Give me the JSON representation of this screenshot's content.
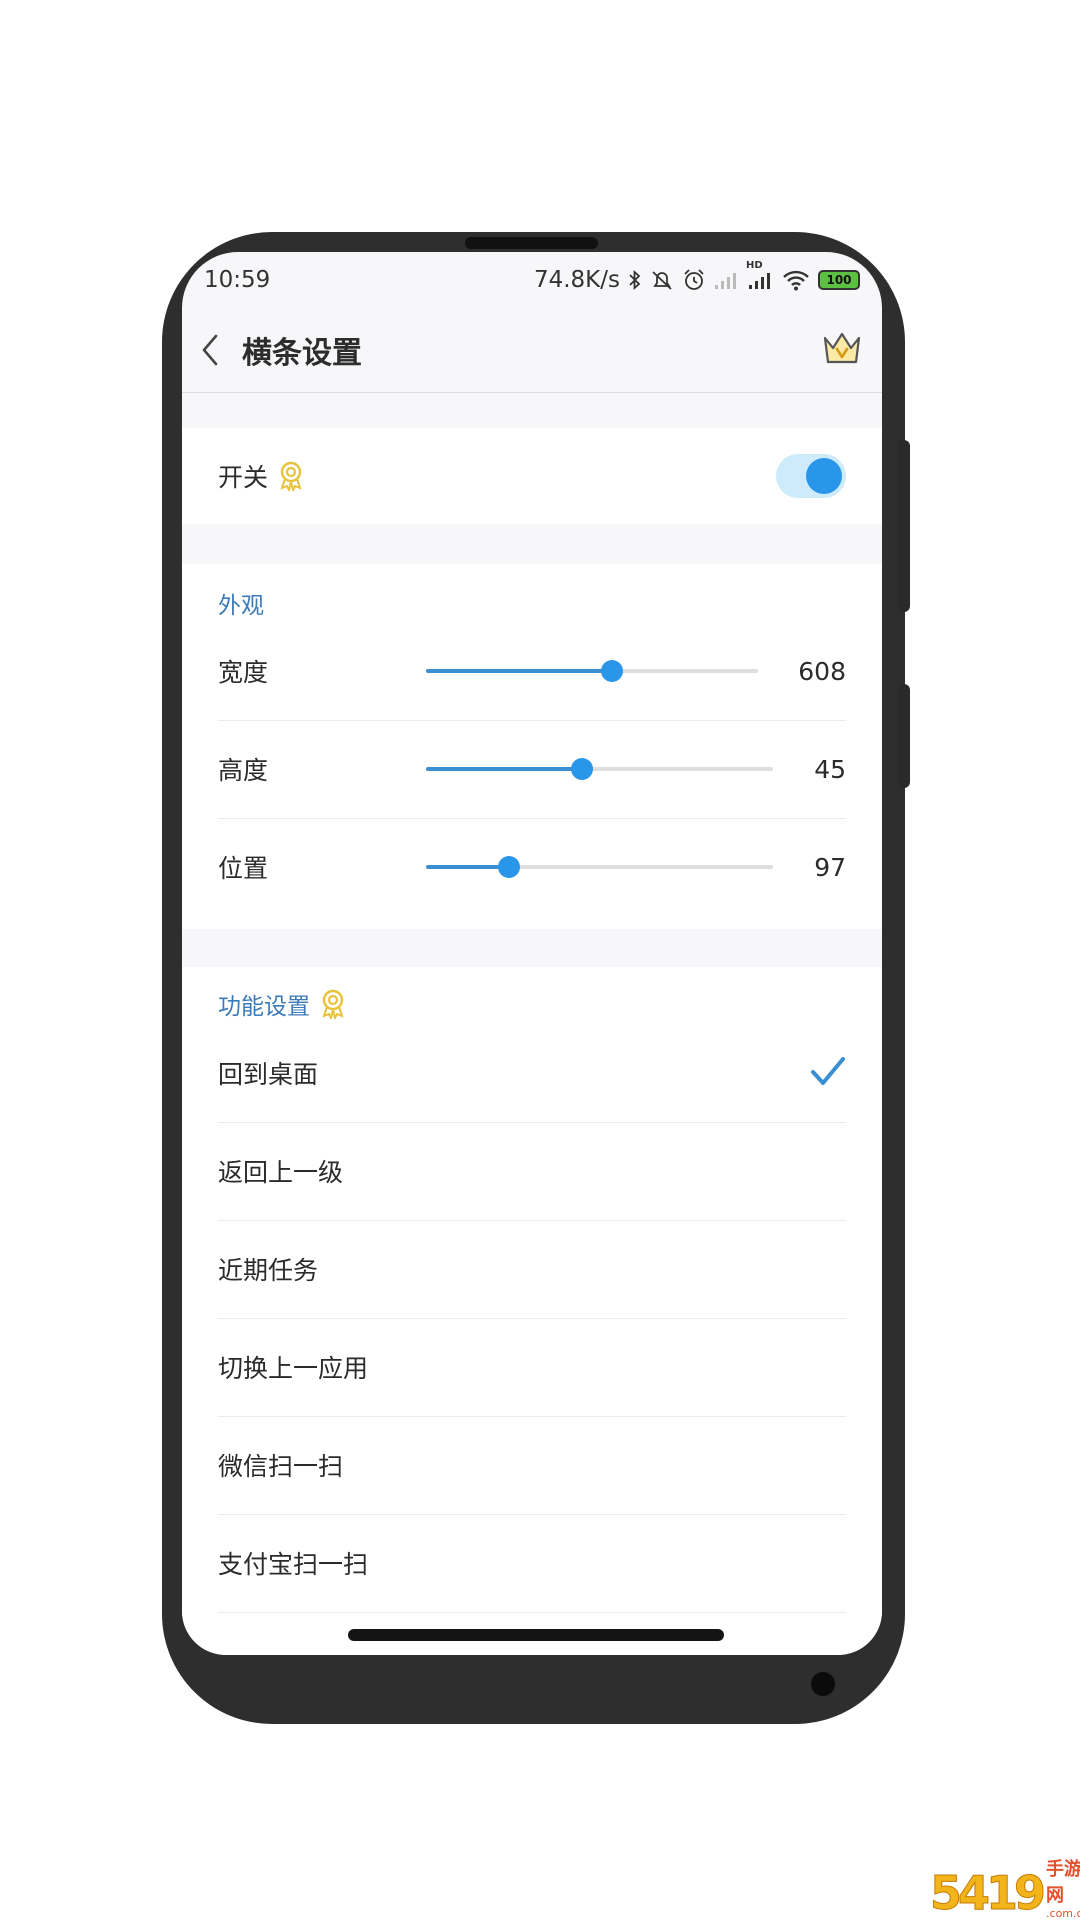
{
  "status_bar": {
    "time": "10:59",
    "speed": "74.8K/s",
    "hd": "HD",
    "battery": "100"
  },
  "title_bar": {
    "title": "横条设置"
  },
  "switch_card": {
    "label": "开关",
    "enabled": true
  },
  "appearance": {
    "header": "外观",
    "sliders": [
      {
        "label": "宽度",
        "value": "608",
        "fill_fraction": 0.56
      },
      {
        "label": "高度",
        "value": "45",
        "fill_fraction": 0.45
      },
      {
        "label": "位置",
        "value": "97",
        "fill_fraction": 0.24
      }
    ]
  },
  "function_settings": {
    "header": "功能设置",
    "items": [
      {
        "label": "回到桌面",
        "selected": true
      },
      {
        "label": "返回上一级",
        "selected": false
      },
      {
        "label": "近期任务",
        "selected": false
      },
      {
        "label": "切换上一应用",
        "selected": false
      },
      {
        "label": "微信扫一扫",
        "selected": false
      },
      {
        "label": "支付宝扫一扫",
        "selected": false
      }
    ]
  },
  "watermark": {
    "number": "5419",
    "text": "手游网",
    "url": ".com.cn"
  },
  "colors": {
    "accent": "#2a96ea",
    "section_header": "#3d7ab8",
    "toggle_track": "#cdebfa"
  }
}
